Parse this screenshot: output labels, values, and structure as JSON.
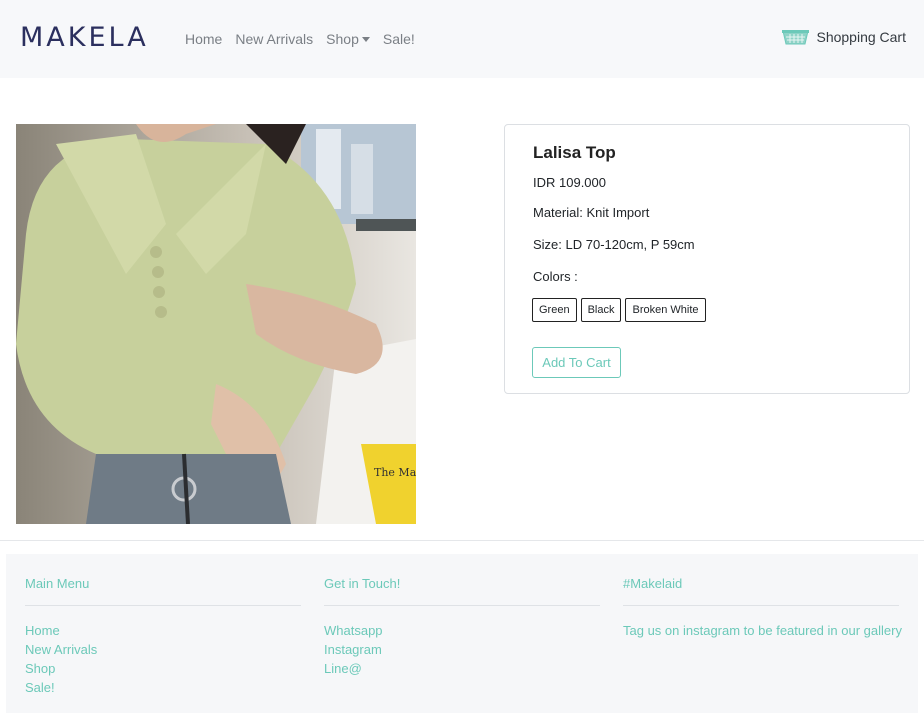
{
  "brand": {
    "logo": "MAKELA"
  },
  "nav": {
    "items": [
      "Home",
      "New Arrivals",
      "Shop",
      "Sale!"
    ],
    "cart_label": "Shopping Cart"
  },
  "product": {
    "name": "Lalisa Top",
    "price": "IDR 109.000",
    "material": "Material: Knit Import",
    "size": "Size: LD 70-120cm, P 59cm",
    "colors_label": "Colors :",
    "colors": [
      "Green",
      "Black",
      "Broken White"
    ],
    "add_to_cart": "Add To Cart",
    "photo_text": "The Ma Guide Bette"
  },
  "footer": {
    "main_menu": {
      "title": "Main Menu",
      "links": [
        "Home",
        "New Arrivals",
        "Shop",
        "Sale!"
      ]
    },
    "contact": {
      "title": "Get in Touch!",
      "links": [
        "Whatsapp",
        "Instagram",
        "Line@"
      ]
    },
    "social": {
      "title": "#Makelaid",
      "text": "Tag us on instagram to be featured in our gallery"
    }
  },
  "colors": {
    "accent": "#6cc9b9",
    "navbar_bg": "#f7f8fa",
    "footer_bg": "#f6f7f9",
    "logo": "#2b2f5e"
  },
  "icons": {
    "cart": "shopping-basket-icon",
    "dropdown": "caret-down-icon"
  }
}
